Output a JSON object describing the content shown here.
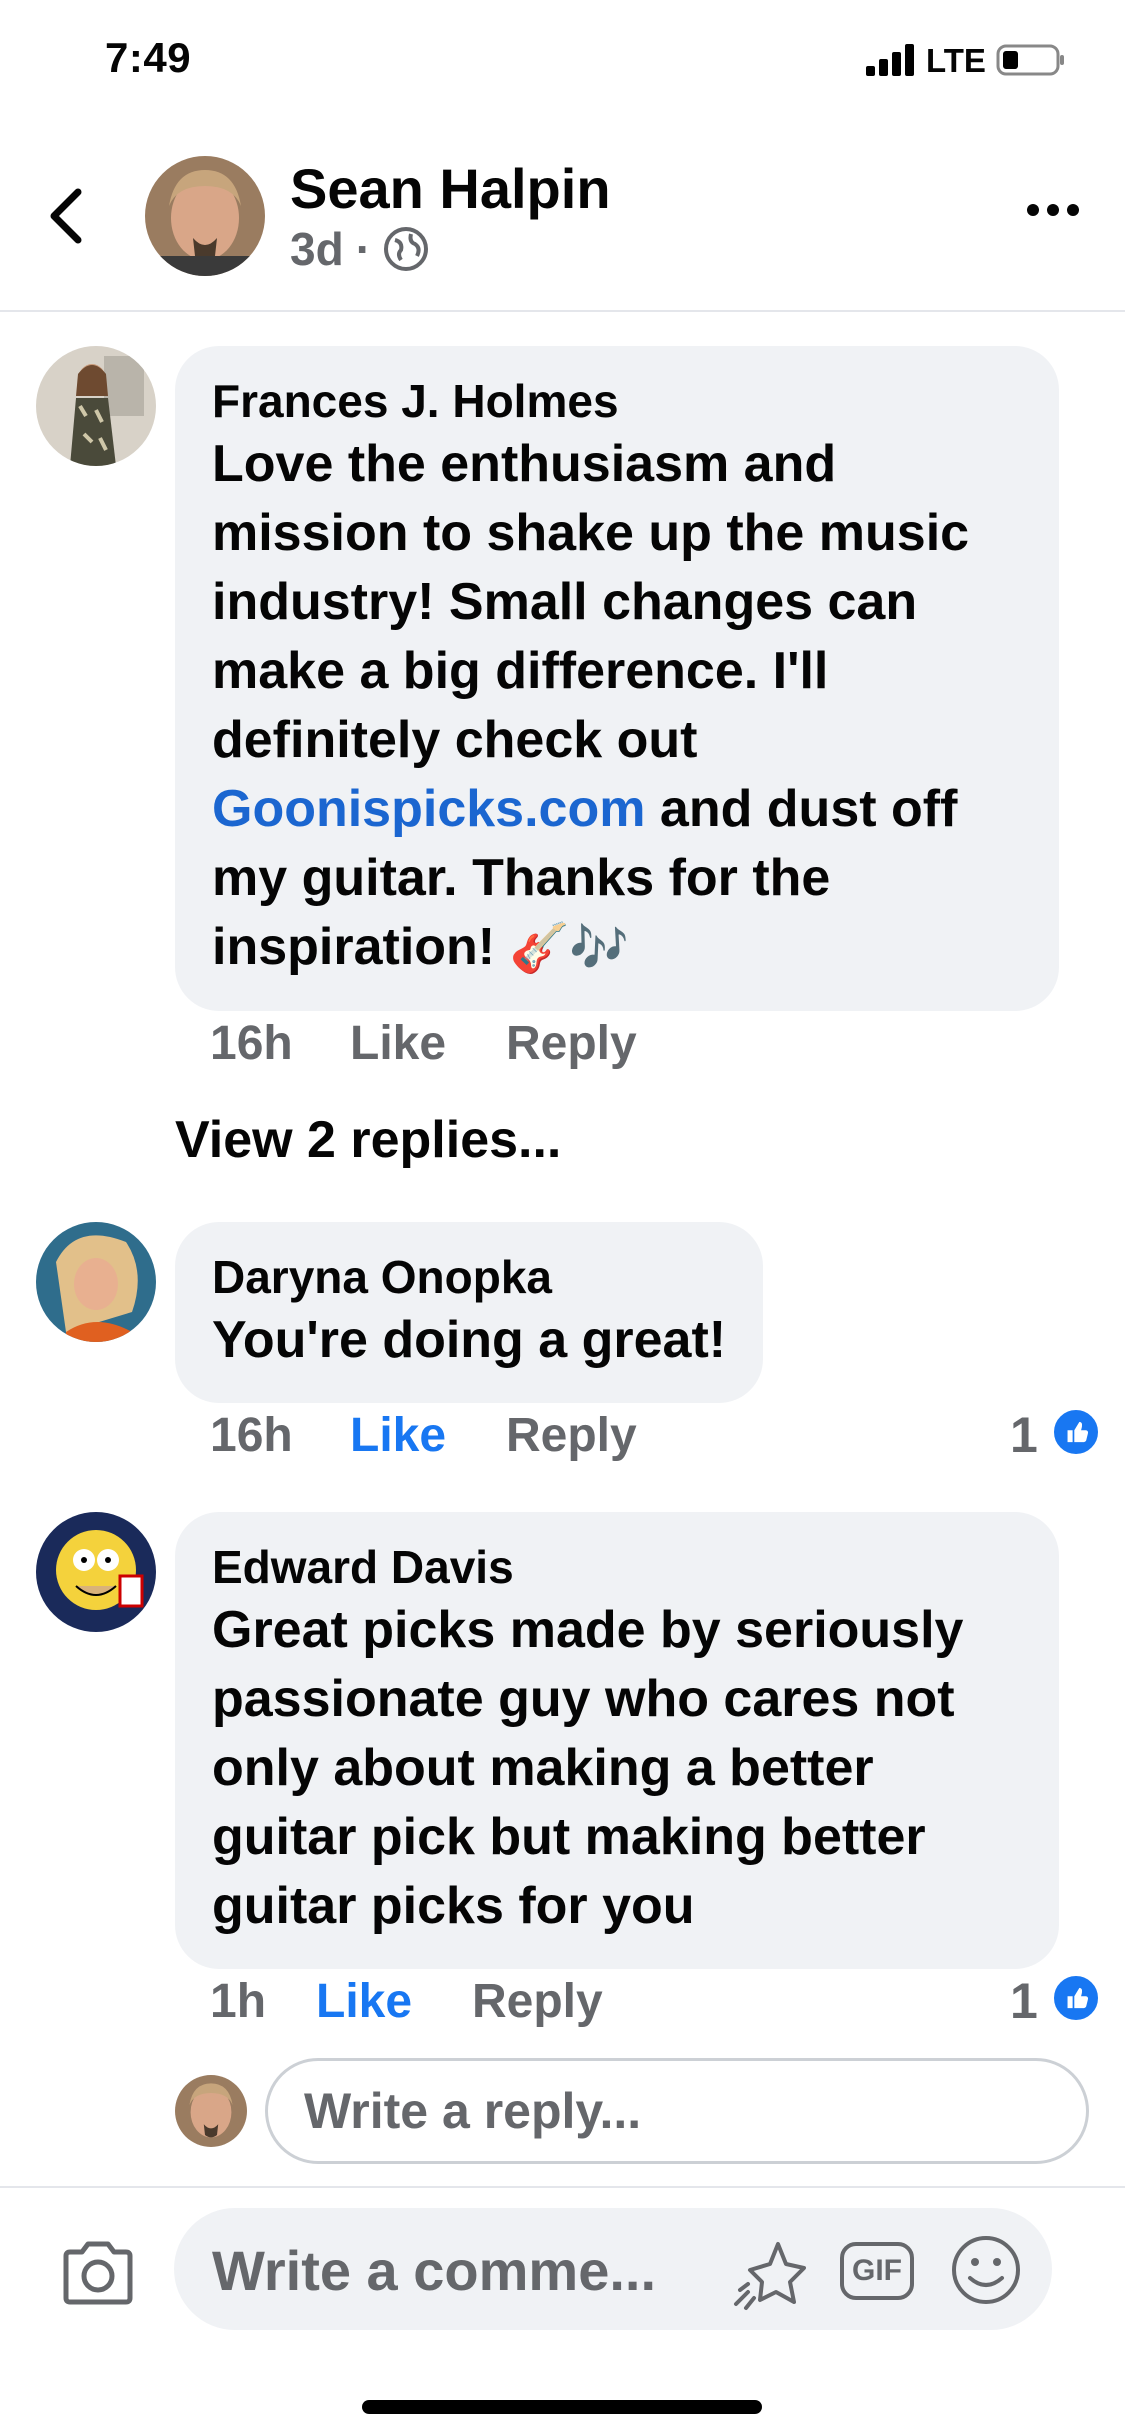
{
  "status_bar": {
    "time": "7:49",
    "network": "LTE"
  },
  "header": {
    "name": "Sean Halpin",
    "age": "3d",
    "separator": "·",
    "privacy_icon": "globe-icon"
  },
  "comments": [
    {
      "author": "Frances J. Holmes",
      "text_before_link": "Love the enthusiasm and mission to shake up the music industry! Small changes can make a big difference. I'll definitely check out ",
      "link": "Goonispicks.com",
      "text_after_link": " and dust off my guitar. Thanks for the inspiration! ",
      "emoji": "🎸🎶",
      "time": "16h",
      "like_label": "Like",
      "reply_label": "Reply",
      "liked": false
    },
    {
      "author": "Daryna Onopka",
      "text": "You're doing a great!",
      "time": "16h",
      "like_label": "Like",
      "reply_label": "Reply",
      "liked": true,
      "reaction_count": "1"
    },
    {
      "author": "Edward Davis",
      "text": "Great picks made by seriously passionate guy who cares not only about making a better guitar pick but making better guitar picks for you",
      "time": "1h",
      "like_label": "Like",
      "reply_label": "Reply",
      "liked": true,
      "reaction_count": "1"
    }
  ],
  "view_replies": "View 2 replies...",
  "reply_input": {
    "placeholder": "Write a reply..."
  },
  "composer": {
    "placeholder": "Write a comme...",
    "gif_label": "GIF"
  },
  "colors": {
    "link": "#1b66d0",
    "accent": "#1877f2",
    "bubble": "#f0f2f5",
    "muted": "#65676b"
  }
}
